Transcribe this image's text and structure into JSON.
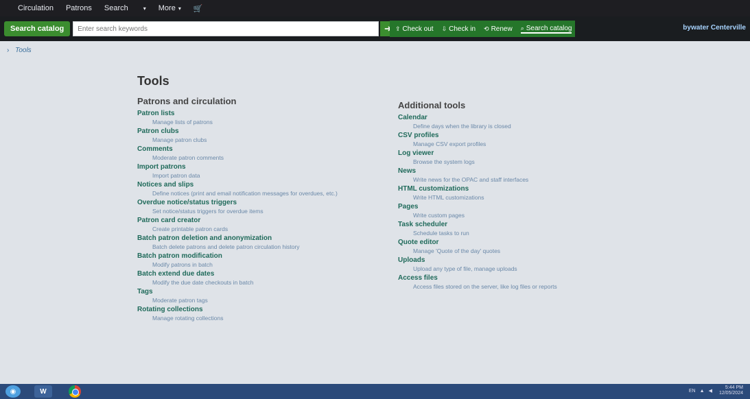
{
  "nav": {
    "items": [
      {
        "label": "Circulation"
      },
      {
        "label": "Patrons"
      },
      {
        "label": "Search"
      }
    ],
    "more_label": "More",
    "caret_glyph": "▾",
    "cart_glyph": "🛒"
  },
  "search": {
    "tab_label": "Search catalog",
    "placeholder": "Enter search keywords",
    "go_glyph": "➜"
  },
  "actions": [
    {
      "label": "Check out",
      "icon": "upload-icon"
    },
    {
      "label": "Check in",
      "icon": "download-icon"
    },
    {
      "label": "Renew",
      "icon": "refresh-icon"
    },
    {
      "label": "Search catalog",
      "icon": "search-icon"
    }
  ],
  "library_name": "bywater Centerville",
  "breadcrumb": {
    "sep": "›",
    "current": "Tools"
  },
  "page_title": "Tools",
  "left_section": {
    "heading": "Patrons and circulation",
    "tools": [
      {
        "name": "Patron lists",
        "desc": "Manage lists of patrons"
      },
      {
        "name": "Patron clubs",
        "desc": "Manage patron clubs"
      },
      {
        "name": "Comments",
        "desc": "Moderate patron comments"
      },
      {
        "name": "Import patrons",
        "desc": "Import patron data"
      },
      {
        "name": "Notices and slips",
        "desc": "Define notices (print and email notification messages for overdues, etc.)"
      },
      {
        "name": "Overdue notice/status triggers",
        "desc": "Set notice/status triggers for overdue items"
      },
      {
        "name": "Patron card creator",
        "desc": "Create printable patron cards"
      },
      {
        "name": "Batch patron deletion and anonymization",
        "desc": "Batch delete patrons and delete patron circulation history"
      },
      {
        "name": "Batch patron modification",
        "desc": "Modify patrons in batch"
      },
      {
        "name": "Batch extend due dates",
        "desc": "Modify the due date checkouts in batch"
      },
      {
        "name": "Tags",
        "desc": "Moderate patron tags"
      },
      {
        "name": "Rotating collections",
        "desc": "Manage rotating collections"
      }
    ]
  },
  "right_section": {
    "heading": "Additional tools",
    "tools": [
      {
        "name": "Calendar",
        "desc": "Define days when the library is closed"
      },
      {
        "name": "CSV profiles",
        "desc": "Manage CSV export profiles"
      },
      {
        "name": "Log viewer",
        "desc": "Browse the system logs"
      },
      {
        "name": "News",
        "desc": "Write news for the OPAC and staff interfaces"
      },
      {
        "name": "HTML customizations",
        "desc": "Write HTML customizations"
      },
      {
        "name": "Pages",
        "desc": "Write custom pages"
      },
      {
        "name": "Task scheduler",
        "desc": "Schedule tasks to run"
      },
      {
        "name": "Quote editor",
        "desc": "Manage 'Quote of the day' quotes"
      },
      {
        "name": "Uploads",
        "desc": "Upload any type of file, manage uploads"
      },
      {
        "name": "Access files",
        "desc": "Access files stored on the server, like log files or reports"
      }
    ]
  },
  "taskbar": {
    "word_label": "W",
    "tray_lang": "EN",
    "clock_time": "5:44 PM",
    "clock_date": "12/05/2024"
  },
  "colors": {
    "accent_green": "#3b8d2f",
    "link_teal": "#1f6a5a",
    "desc_blue": "#6a88a8"
  }
}
